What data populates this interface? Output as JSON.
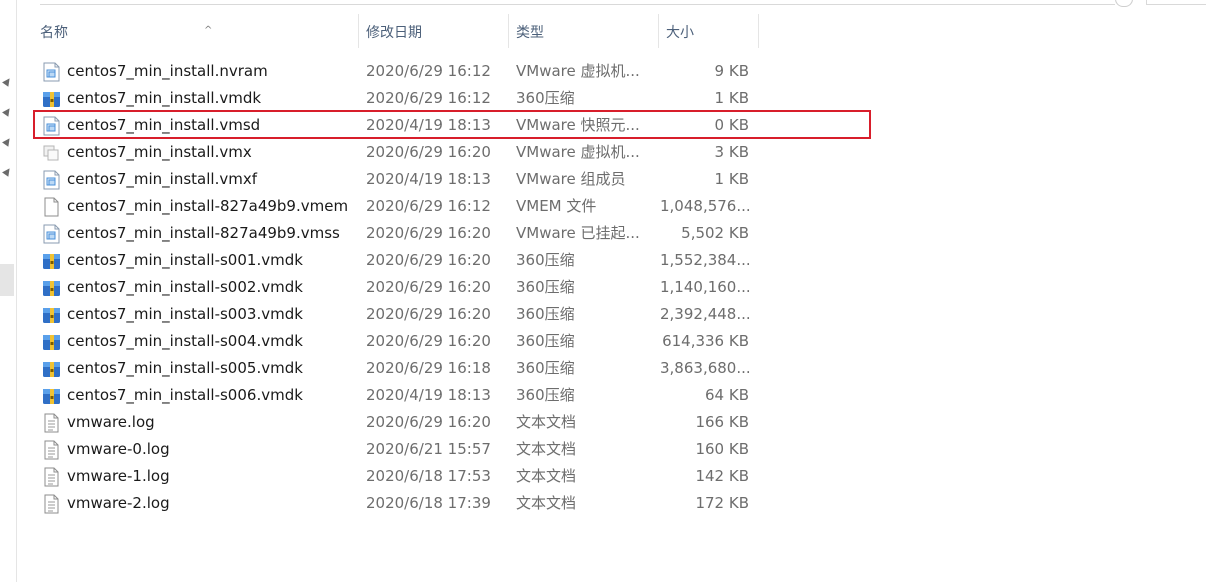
{
  "columns": {
    "name": "名称",
    "modified": "修改日期",
    "type": "类型",
    "size": "大小"
  },
  "files": [
    {
      "name": "centos7_min_install.nvram",
      "modified": "2020/6/29 16:12",
      "type": "VMware 虚拟机...",
      "size": "9 KB",
      "icon": "vmware-doc-icon"
    },
    {
      "name": "centos7_min_install.vmdk",
      "modified": "2020/6/29 16:12",
      "type": "360压缩",
      "size": "1 KB",
      "icon": "archive-icon"
    },
    {
      "name": "centos7_min_install.vmsd",
      "modified": "2020/4/19 18:13",
      "type": "VMware 快照元...",
      "size": "0 KB",
      "icon": "vmware-doc-icon"
    },
    {
      "name": "centos7_min_install.vmx",
      "modified": "2020/6/29 16:20",
      "type": "VMware 虚拟机...",
      "size": "3 KB",
      "icon": "vmware-vm-icon"
    },
    {
      "name": "centos7_min_install.vmxf",
      "modified": "2020/4/19 18:13",
      "type": "VMware 组成员",
      "size": "1 KB",
      "icon": "vmware-doc-icon"
    },
    {
      "name": "centos7_min_install-827a49b9.vmem",
      "modified": "2020/6/29 16:12",
      "type": "VMEM 文件",
      "size": "1,048,576...",
      "icon": "blank-file-icon"
    },
    {
      "name": "centos7_min_install-827a49b9.vmss",
      "modified": "2020/6/29 16:20",
      "type": "VMware 已挂起...",
      "size": "5,502 KB",
      "icon": "vmware-doc-icon"
    },
    {
      "name": "centos7_min_install-s001.vmdk",
      "modified": "2020/6/29 16:20",
      "type": "360压缩",
      "size": "1,552,384...",
      "icon": "archive-icon"
    },
    {
      "name": "centos7_min_install-s002.vmdk",
      "modified": "2020/6/29 16:20",
      "type": "360压缩",
      "size": "1,140,160...",
      "icon": "archive-icon"
    },
    {
      "name": "centos7_min_install-s003.vmdk",
      "modified": "2020/6/29 16:20",
      "type": "360压缩",
      "size": "2,392,448...",
      "icon": "archive-icon"
    },
    {
      "name": "centos7_min_install-s004.vmdk",
      "modified": "2020/6/29 16:20",
      "type": "360压缩",
      "size": "614,336 KB",
      "icon": "archive-icon"
    },
    {
      "name": "centos7_min_install-s005.vmdk",
      "modified": "2020/6/29 16:18",
      "type": "360压缩",
      "size": "3,863,680...",
      "icon": "archive-icon"
    },
    {
      "name": "centos7_min_install-s006.vmdk",
      "modified": "2020/4/19 18:13",
      "type": "360压缩",
      "size": "64 KB",
      "icon": "archive-icon"
    },
    {
      "name": "vmware.log",
      "modified": "2020/6/29 16:20",
      "type": "文本文档",
      "size": "166 KB",
      "icon": "text-file-icon"
    },
    {
      "name": "vmware-0.log",
      "modified": "2020/6/21 15:57",
      "type": "文本文档",
      "size": "160 KB",
      "icon": "text-file-icon"
    },
    {
      "name": "vmware-1.log",
      "modified": "2020/6/18 17:53",
      "type": "文本文档",
      "size": "142 KB",
      "icon": "text-file-icon"
    },
    {
      "name": "vmware-2.log",
      "modified": "2020/6/18 17:39",
      "type": "文本文档",
      "size": "172 KB",
      "icon": "text-file-icon"
    }
  ],
  "highlighted_file": "centos7_min_install.vmsd",
  "colors": {
    "highlight_border": "#d81e2b",
    "header_text": "#4c607a",
    "secondary_text": "#6d6d6d"
  }
}
